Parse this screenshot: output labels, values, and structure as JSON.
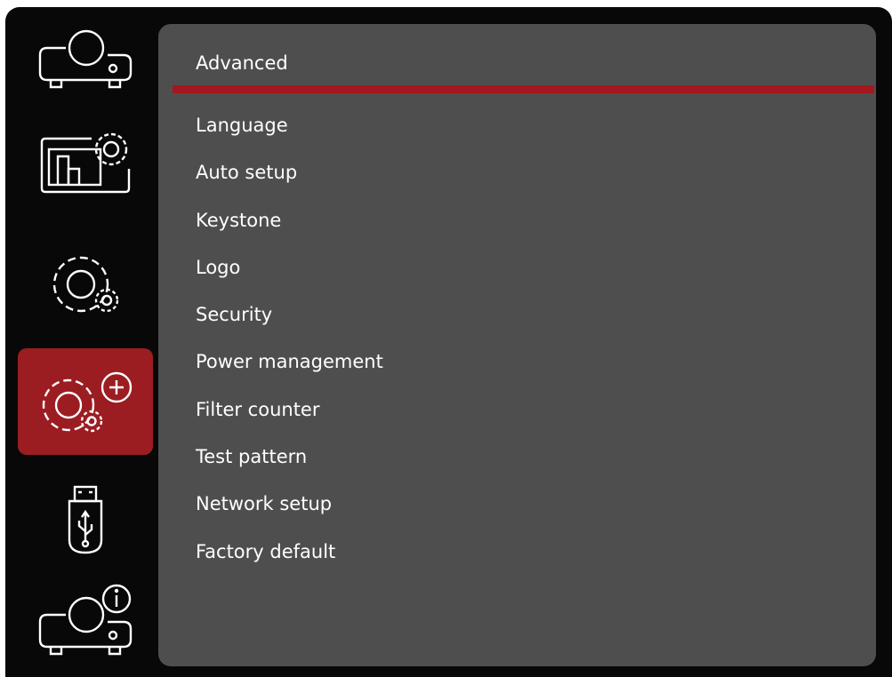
{
  "sidebar": {
    "items": [
      {
        "icon": "projector-icon",
        "active": false
      },
      {
        "icon": "picture-settings-icon",
        "active": false
      },
      {
        "icon": "settings-gear-icon",
        "active": false
      },
      {
        "icon": "advanced-settings-icon",
        "active": true
      },
      {
        "icon": "usb-drive-icon",
        "active": false
      },
      {
        "icon": "projector-info-icon",
        "active": false
      }
    ]
  },
  "panel": {
    "title": "Advanced",
    "menu": [
      "Language",
      "Auto setup",
      "Keystone",
      "Logo",
      "Security",
      "Power management",
      "Filter counter",
      "Test pattern",
      "Network setup",
      "Factory default"
    ]
  },
  "colors": {
    "background": "#080808",
    "panel": "#4e4e4e",
    "accent": "#9b1d22",
    "text": "#ffffff"
  }
}
